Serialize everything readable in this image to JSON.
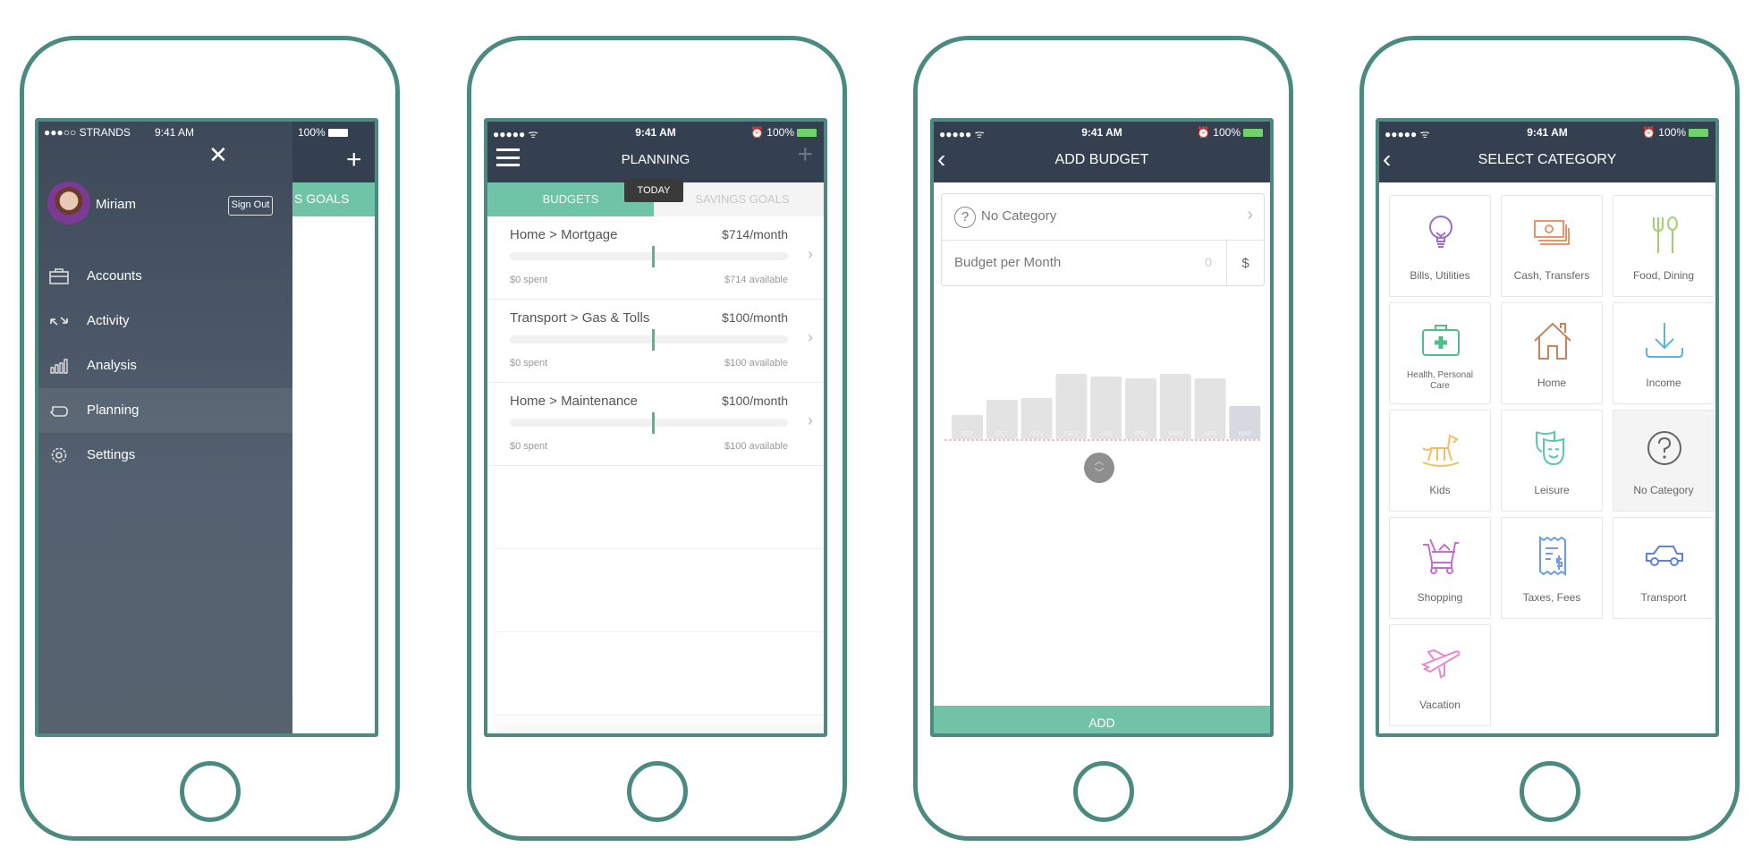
{
  "status": {
    "carrier": "STRANDS",
    "time": "9:41 AM",
    "battery": "100%"
  },
  "menu": {
    "user_name": "Miriam",
    "sign_out": "Sign Out",
    "behind_tab": "S GOALS",
    "items": [
      {
        "label": "Accounts",
        "icon": "briefcase-icon"
      },
      {
        "label": "Activity",
        "icon": "transfer-arrows-icon"
      },
      {
        "label": "Analysis",
        "icon": "bar-chart-icon"
      },
      {
        "label": "Planning",
        "icon": "piggy-bank-icon",
        "active": true
      },
      {
        "label": "Settings",
        "icon": "gear-icon"
      }
    ]
  },
  "planning": {
    "title": "PLANNING",
    "tabs": [
      {
        "label": "BUDGETS",
        "active": true
      },
      {
        "label": "SAVINGS GOALS"
      }
    ],
    "today_tooltip": "TODAY",
    "budgets": [
      {
        "title": "Home > Mortgage",
        "amount": "$714/month",
        "spent": "$0 spent",
        "available": "$714 available",
        "progress": 0
      },
      {
        "title": "Transport > Gas & Tolls",
        "amount": "$100/month",
        "spent": "$0 spent",
        "available": "$100 available",
        "progress": 0
      },
      {
        "title": "Home > Maintenance",
        "amount": "$100/month",
        "spent": "$0 spent",
        "available": "$100 available",
        "progress": 0
      }
    ]
  },
  "add_budget": {
    "title": "ADD BUDGET",
    "category": "No Category",
    "budget_label": "Budget per Month",
    "budget_value": "0",
    "currency": "$",
    "add_label": "ADD"
  },
  "chart_data": {
    "type": "bar",
    "categories": [
      "SEP",
      "OCT",
      "NOV",
      "DEC",
      "JAN",
      "FEB",
      "MAR",
      "APR",
      "MAY"
    ],
    "values": [
      27,
      44,
      46,
      73,
      70,
      68,
      73,
      68,
      37
    ],
    "highlighted": "MAY",
    "colors": {
      "bar": "#e3e3e3",
      "highlight": "#d6d9e0"
    }
  },
  "select_category": {
    "title": "SELECT CATEGORY",
    "categories": [
      {
        "label": "Bills, Utilities",
        "icon": "lightbulb-icon",
        "color": "#9b6fc4"
      },
      {
        "label": "Cash, Transfers",
        "icon": "cash-icon",
        "color": "#e9946a"
      },
      {
        "label": "Food, Dining",
        "icon": "fork-spoon-icon",
        "color": "#a3cf6f"
      },
      {
        "label": "Health, Personal Care",
        "icon": "first-aid-icon",
        "color": "#4fbf8a"
      },
      {
        "label": "Home",
        "icon": "house-icon",
        "color": "#c8825c"
      },
      {
        "label": "Income",
        "icon": "download-icon",
        "color": "#5ab3e0"
      },
      {
        "label": "Kids",
        "icon": "rocking-horse-icon",
        "color": "#f0c062"
      },
      {
        "label": "Leisure",
        "icon": "theater-masks-icon",
        "color": "#5cc8a8"
      },
      {
        "label": "No Category",
        "icon": "question-icon",
        "color": "#666666",
        "selected": true
      },
      {
        "label": "Shopping",
        "icon": "cart-icon",
        "color": "#c46fd0"
      },
      {
        "label": "Taxes, Fees",
        "icon": "receipt-icon",
        "color": "#6f9be6"
      },
      {
        "label": "Transport",
        "icon": "car-icon",
        "color": "#5d82d6"
      },
      {
        "label": "Vacation",
        "icon": "airplane-icon",
        "color": "#e68ac8"
      }
    ]
  },
  "colors": {
    "accent": "#6fc3a6",
    "header": "#34404f",
    "frame": "#4b8a80"
  }
}
